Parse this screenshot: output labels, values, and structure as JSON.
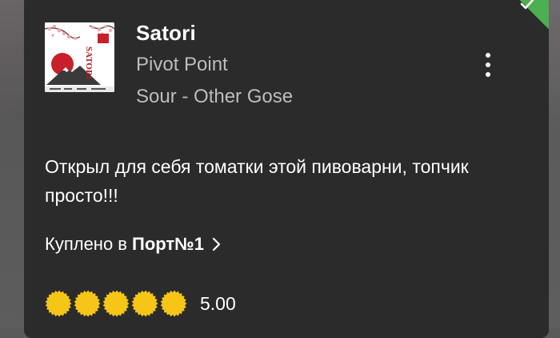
{
  "checkin": {
    "beer_name": "Satori",
    "brewery": "Pivot Point",
    "style": "Sour - Other Gose",
    "comment": "Открыл для себя томатки этой пивоварни, топчик просто!!!",
    "purchased_prefix": "Куплено в",
    "venue": "Порт№1",
    "rating": 5.0,
    "rating_text": "5.00",
    "rating_max": 5,
    "label_art_text": "SATORI"
  },
  "icons": {
    "menu": "more-vertical-icon",
    "venue_link": "chevron-right-icon",
    "verified": "check-icon",
    "rating": "bottle-cap-icon"
  },
  "colors": {
    "card_bg": "#2b2b2b",
    "primary_text": "#ffffff",
    "secondary_text": "#bdbdbd",
    "rating_cap": "#f5c518",
    "badge": "#4caf50"
  }
}
